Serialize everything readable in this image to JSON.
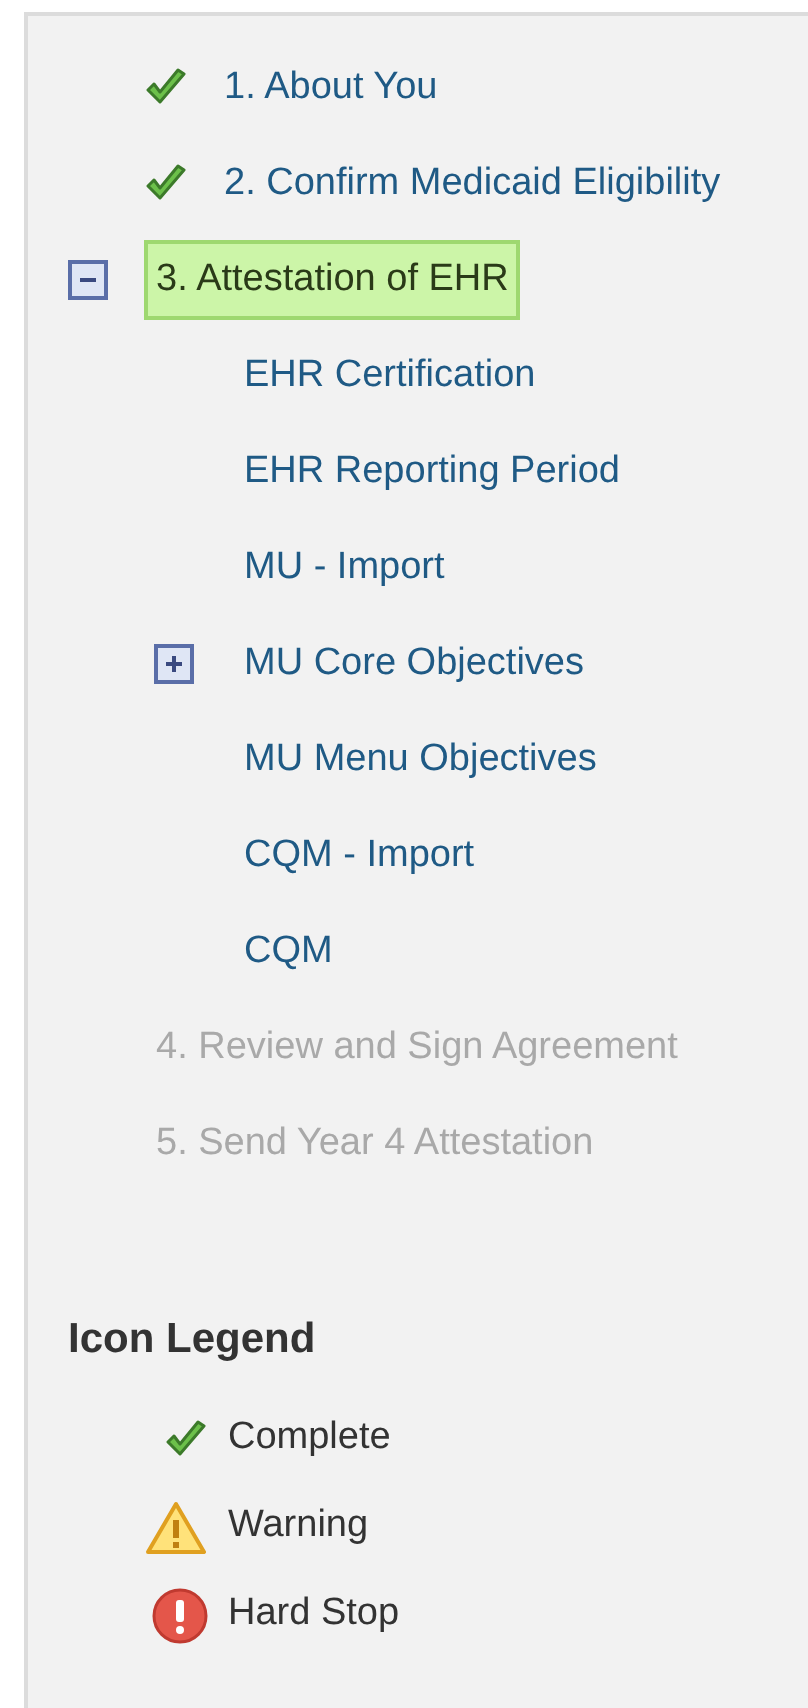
{
  "steps": [
    {
      "label": "1. About You",
      "kind": "complete",
      "selected": false
    },
    {
      "label": "2. Confirm Medicaid Eligibility",
      "kind": "complete",
      "selected": false
    },
    {
      "label": "3. Attestation of EHR",
      "kind": "current",
      "selected": true,
      "expanded": true,
      "children": [
        {
          "label": "EHR Certification",
          "kind": "page"
        },
        {
          "label": "EHR Reporting Period",
          "kind": "page"
        },
        {
          "label": "MU - Import",
          "kind": "page"
        },
        {
          "label": "MU Core Objectives",
          "kind": "group",
          "expanded": false
        },
        {
          "label": "MU Menu Objectives",
          "kind": "page"
        },
        {
          "label": "CQM - Import",
          "kind": "page"
        },
        {
          "label": "CQM",
          "kind": "page"
        }
      ]
    },
    {
      "label": "4. Review and Sign Agreement",
      "kind": "locked",
      "selected": false
    },
    {
      "label": "5. Send Year 4 Attestation",
      "kind": "locked",
      "selected": false
    }
  ],
  "legend": {
    "title": "Icon Legend",
    "items": [
      {
        "kind": "complete",
        "label": "Complete"
      },
      {
        "kind": "warning",
        "label": "Warning"
      },
      {
        "kind": "hardstop",
        "label": "Hard Stop"
      }
    ]
  }
}
